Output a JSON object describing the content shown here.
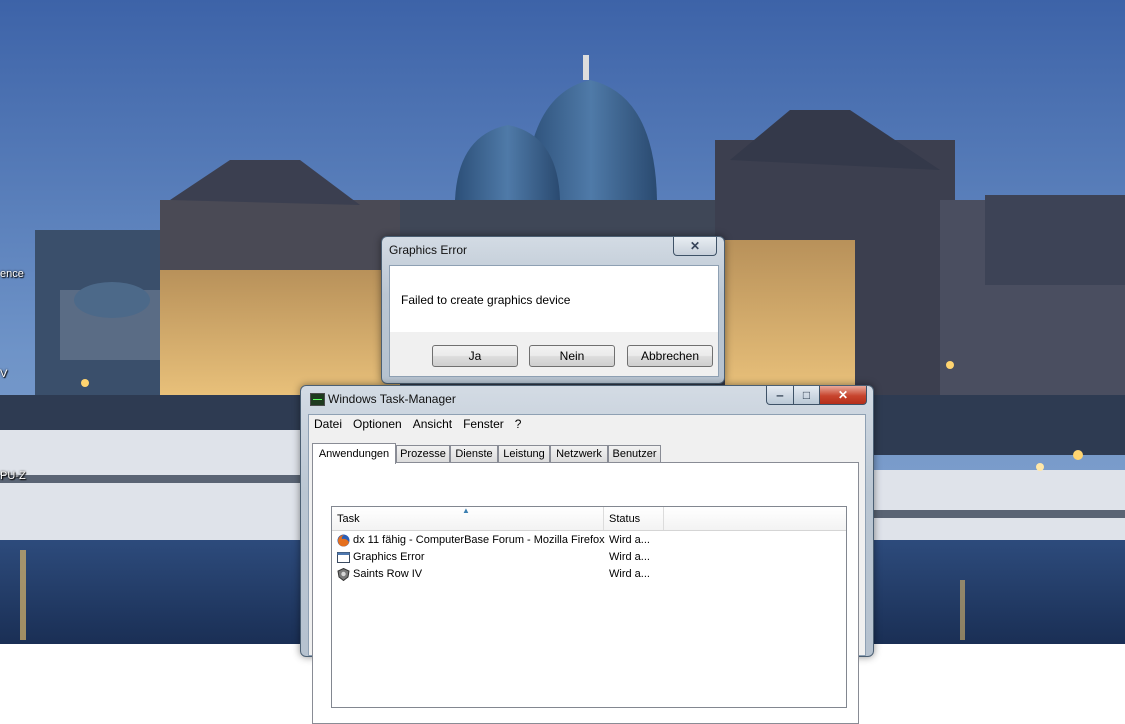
{
  "desktop": {
    "fragments": [
      "ence",
      "V",
      "PU-Z"
    ]
  },
  "graphics_error": {
    "title": "Graphics Error",
    "close_glyph": "✕",
    "message": "Failed to create graphics device",
    "buttons": {
      "yes": "Ja",
      "no": "Nein",
      "cancel": "Abbrechen"
    }
  },
  "task_manager": {
    "title": "Windows Task-Manager",
    "window_buttons": {
      "minimize": "‒",
      "maximize": "□",
      "close": "✕"
    },
    "menu": [
      "Datei",
      "Optionen",
      "Ansicht",
      "Fenster",
      "?"
    ],
    "tabs": [
      "Anwendungen",
      "Prozesse",
      "Dienste",
      "Leistung",
      "Netzwerk",
      "Benutzer"
    ],
    "active_tab": "Anwendungen",
    "columns": {
      "task": "Task",
      "status": "Status"
    },
    "sort_indicator": "▲",
    "rows": [
      {
        "task": "dx 11 fähig - ComputerBase Forum - Mozilla Firefox",
        "status": "Wird a...",
        "icon": "firefox-icon"
      },
      {
        "task": "Graphics Error",
        "status": "Wird a...",
        "icon": "window-icon"
      },
      {
        "task": "Saints Row IV",
        "status": "Wird a...",
        "icon": "saints-row-icon"
      }
    ]
  }
}
